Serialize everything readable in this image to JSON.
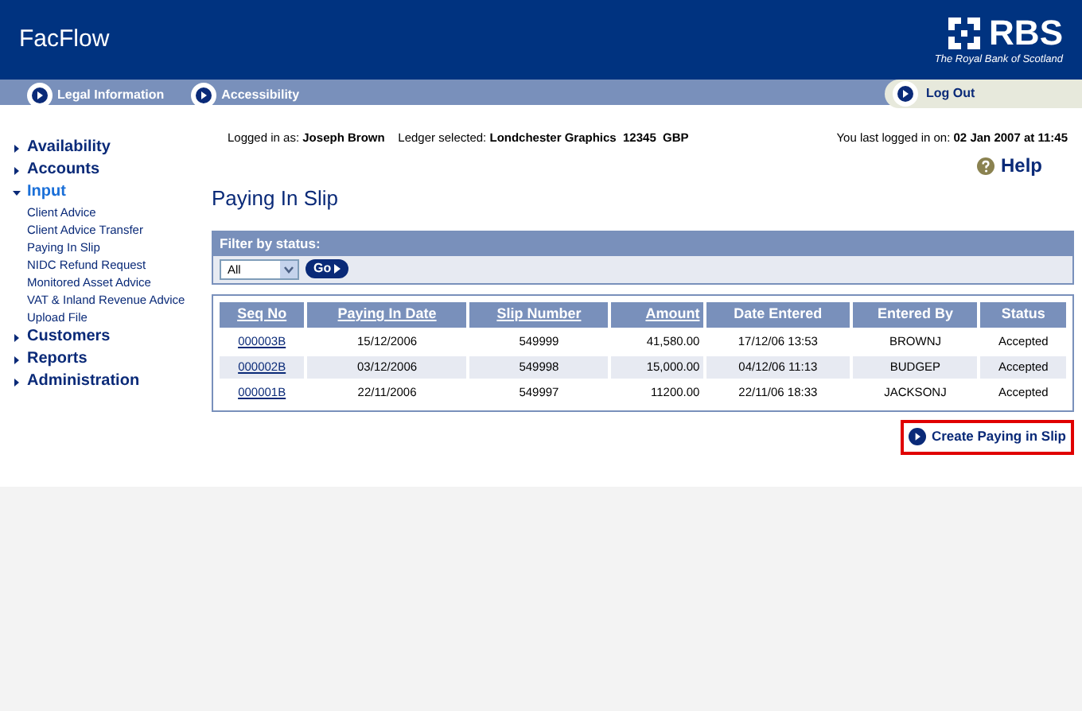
{
  "header": {
    "title": "FacFlow",
    "logo_text": "RBS",
    "logo_tagline": "The Royal Bank of Scotland"
  },
  "nav": {
    "links": [
      "Legal Information",
      "Accessibility"
    ],
    "logout": "Log Out"
  },
  "sidebar": {
    "items": [
      {
        "label": "Availability",
        "expanded": false
      },
      {
        "label": "Accounts",
        "expanded": false
      },
      {
        "label": "Input",
        "expanded": true,
        "children": [
          "Client Advice",
          "Client Advice Transfer",
          "Paying In Slip",
          "NIDC Refund Request",
          "Monitored Asset Advice",
          "VAT & Inland Revenue Advice",
          "Upload File"
        ]
      },
      {
        "label": "Customers",
        "expanded": false
      },
      {
        "label": "Reports",
        "expanded": false
      },
      {
        "label": "Administration",
        "expanded": false
      }
    ]
  },
  "info": {
    "logged_in_label": "Logged in as:",
    "user": "Joseph Brown",
    "ledger_label": "Ledger selected:",
    "ledger": "Londchester Graphics  12345  GBP",
    "last_login_label": "You last logged in on:",
    "last_login": "02 Jan 2007 at 11:45"
  },
  "help": "Help",
  "page_title": "Paying In Slip",
  "filter": {
    "title": "Filter by status:",
    "value": "All",
    "go": "Go"
  },
  "table": {
    "columns": [
      {
        "label": "Seq No",
        "sortable": true
      },
      {
        "label": "Paying In Date",
        "sortable": true
      },
      {
        "label": "Slip Number",
        "sortable": true
      },
      {
        "label": "Amount",
        "sortable": true
      },
      {
        "label": "Date Entered",
        "sortable": false
      },
      {
        "label": "Entered By",
        "sortable": false
      },
      {
        "label": "Status",
        "sortable": false
      }
    ],
    "rows": [
      [
        "000003B",
        "15/12/2006",
        "549999",
        "41,580.00",
        "17/12/06 13:53",
        "BROWNJ",
        "Accepted"
      ],
      [
        "000002B",
        "03/12/2006",
        "549998",
        "15,000.00",
        "04/12/06 11:13",
        "BUDGEP",
        "Accepted"
      ],
      [
        "000001B",
        "22/11/2006",
        "549997",
        "11200.00",
        "22/11/06 18:33",
        "JACKSONJ",
        "Accepted"
      ]
    ]
  },
  "create_button": "Create Paying in Slip"
}
